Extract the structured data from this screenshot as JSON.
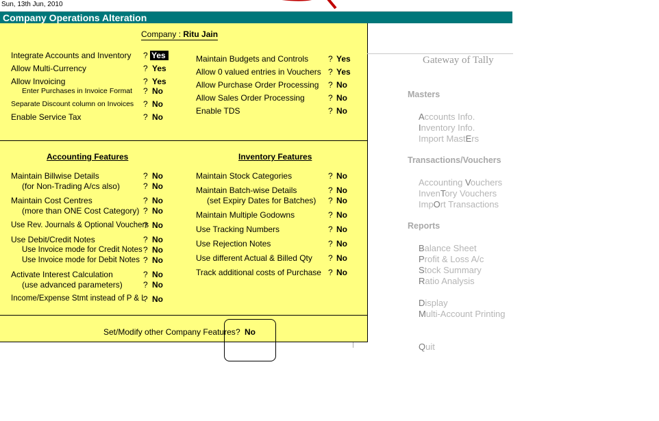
{
  "top_bar": {
    "date": "Sun, 13th Jun, 2010"
  },
  "title_bar": {
    "title": "Company Operations Alteration"
  },
  "company": {
    "label": "Company :",
    "name": "Ritu Jain"
  },
  "general_left": [
    {
      "label": "Integrate Accounts and Inventory",
      "q": "?",
      "value": "Yes",
      "highlighted": true
    },
    {
      "label": "Allow Multi-Currency",
      "q": "?",
      "value": "Yes"
    },
    {
      "label": "Allow Invoicing",
      "q": "?",
      "value": "Yes"
    },
    {
      "label": "Enter Purchases in Invoice Format",
      "q": "?",
      "value": "No"
    },
    {
      "label": "Separate Discount column on Invoices",
      "q": "?",
      "value": "No"
    },
    {
      "label": "Enable Service Tax",
      "q": "?",
      "value": "No"
    }
  ],
  "general_right": [
    {
      "label": "Maintain Budgets and Controls",
      "q": "?",
      "value": "Yes"
    },
    {
      "label": "Allow 0 valued entries in Vouchers",
      "q": "?",
      "value": "Yes"
    },
    {
      "label": "Allow Purchase Order Processing",
      "q": "?",
      "value": "No"
    },
    {
      "label": "Allow Sales Order Processing",
      "q": "?",
      "value": "No"
    },
    {
      "label": "Enable TDS",
      "q": "?",
      "value": "No"
    }
  ],
  "accounting": {
    "heading": "Accounting Features",
    "rows": [
      {
        "label": "Maintain Billwise Details",
        "q": "?",
        "value": "No"
      },
      {
        "label": "(for Non-Trading A/cs also)",
        "q": "?",
        "value": "No"
      },
      {
        "label": "Maintain Cost Centres",
        "q": "?",
        "value": "No"
      },
      {
        "label": "(more than ONE Cost Category)",
        "q": "?",
        "value": "No"
      },
      {
        "label": "Use Rev. Journals & Optional Vouchers",
        "q": "?",
        "value": "No"
      },
      {
        "label": "Use Debit/Credit Notes",
        "q": "?",
        "value": "No"
      },
      {
        "label": "Use Invoice mode for Credit Notes",
        "q": "?",
        "value": "No"
      },
      {
        "label": "Use Invoice mode for Debit Notes",
        "q": "?",
        "value": "No"
      },
      {
        "label": "Activate Interest Calculation",
        "q": "?",
        "value": "No"
      },
      {
        "label": "(use advanced parameters)",
        "q": "?",
        "value": "No"
      },
      {
        "label": "Income/Expense Stmt instead of P & L",
        "q": "?",
        "value": "No"
      }
    ]
  },
  "inventory": {
    "heading": "Inventory Features",
    "rows": [
      {
        "label": "Maintain Stock Categories",
        "q": "?",
        "value": "No"
      },
      {
        "label": "Maintain Batch-wise Details",
        "q": "?",
        "value": "No"
      },
      {
        "label": "(set Expiry Dates for Batches)",
        "q": "?",
        "value": "No"
      },
      {
        "label": "Maintain Multiple Godowns",
        "q": "?",
        "value": "No"
      },
      {
        "label": "Use Tracking Numbers",
        "q": "?",
        "value": "No"
      },
      {
        "label": "Use Rejection Notes",
        "q": "?",
        "value": "No"
      },
      {
        "label": "Use different Actual & Billed Qty",
        "q": "?",
        "value": "No"
      },
      {
        "label": "Track additional costs of Purchase",
        "q": "?",
        "value": "No"
      }
    ]
  },
  "footer": {
    "label": "Set/Modify other Company Features",
    "q": "?",
    "value": "No"
  },
  "gateway": {
    "title": "Gateway of Tally",
    "masters": {
      "heading": "Masters",
      "items": [
        {
          "pre": "",
          "key": "A",
          "post": "ccounts Info."
        },
        {
          "pre": "",
          "key": "I",
          "post": "nventory Info."
        },
        {
          "pre": "Import Mast",
          "key": "E",
          "post": "rs"
        }
      ]
    },
    "transactions": {
      "heading": "Transactions/Vouchers",
      "items": [
        {
          "pre": "Accounting ",
          "key": "V",
          "post": "ouchers"
        },
        {
          "pre": "Inven",
          "key": "T",
          "post": "ory Vouchers"
        },
        {
          "pre": "Imp",
          "key": "O",
          "post": "rt Transactions"
        }
      ]
    },
    "reports": {
      "heading": "Reports",
      "items": [
        {
          "pre": "",
          "key": "B",
          "post": "alance Sheet"
        },
        {
          "pre": "",
          "key": "P",
          "post": "rofit & Loss A/c"
        },
        {
          "pre": "",
          "key": "S",
          "post": "tock Summary"
        },
        {
          "pre": "",
          "key": "R",
          "post": "atio Analysis"
        },
        {
          "pre": "",
          "key": "D",
          "post": "isplay"
        },
        {
          "pre": "",
          "key": "M",
          "post": "ulti-Account Printing"
        },
        {
          "pre": "",
          "key": "Q",
          "post": "uit"
        }
      ]
    }
  },
  "colors": {
    "panel": "#ffff80",
    "titlebar": "#00777a",
    "gateway_text": "#b5b5b5"
  }
}
